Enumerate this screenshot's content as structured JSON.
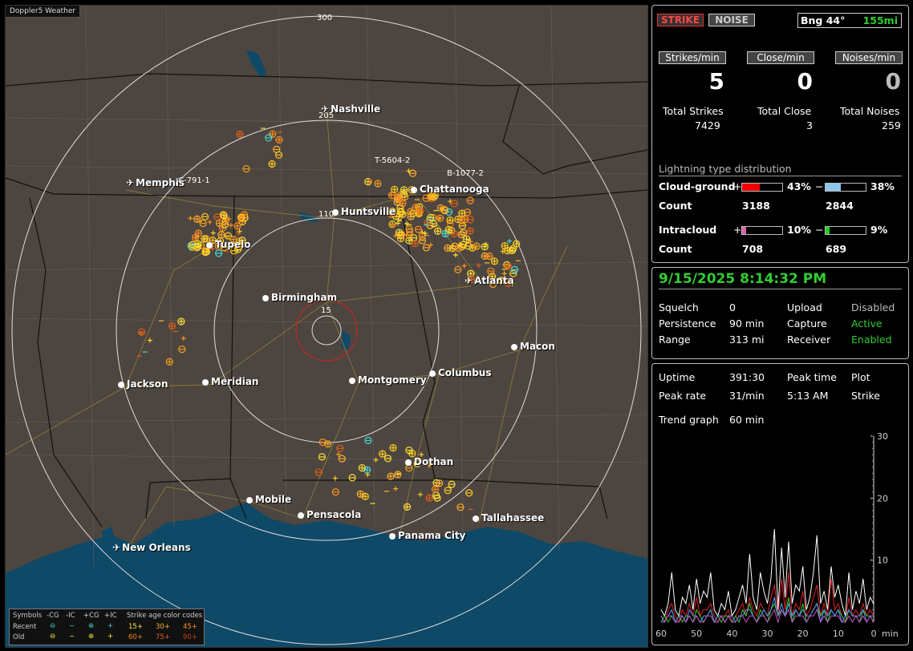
{
  "app_title": "Doppler5 Weather",
  "map": {
    "range_labels": [
      "300",
      "205",
      "110",
      "15"
    ],
    "cities": [
      {
        "name": "Nashville",
        "kind": "airport"
      },
      {
        "name": "Memphis",
        "kind": "airport"
      },
      {
        "name": "Chattanooga",
        "kind": "city"
      },
      {
        "name": "Huntsville",
        "kind": "city"
      },
      {
        "name": "Tupelo",
        "kind": "city"
      },
      {
        "name": "Atlanta",
        "kind": "airport"
      },
      {
        "name": "Birmingham",
        "kind": "city"
      },
      {
        "name": "Macon",
        "kind": "city"
      },
      {
        "name": "Jackson",
        "kind": "city"
      },
      {
        "name": "Meridian",
        "kind": "city"
      },
      {
        "name": "Montgomery",
        "kind": "city"
      },
      {
        "name": "Columbus",
        "kind": "city"
      },
      {
        "name": "Dothan",
        "kind": "city"
      },
      {
        "name": "Mobile",
        "kind": "city"
      },
      {
        "name": "Pensacola",
        "kind": "city"
      },
      {
        "name": "Tallahassee",
        "kind": "city"
      },
      {
        "name": "Panama City",
        "kind": "city"
      },
      {
        "name": "New Orleans",
        "kind": "airport"
      }
    ],
    "cell_labels": [
      "T-5604-2",
      "B-1077-2",
      "C-791-1"
    ],
    "legend": {
      "symbols_label": "Symbols",
      "headers": [
        "-CG",
        "-IC",
        "+CG",
        "+IC"
      ],
      "recent_label": "Recent",
      "old_label": "Old",
      "age_title": "Strike age color codes",
      "recent_ages": [
        "15+",
        "30+",
        "45+"
      ],
      "old_ages": [
        "60+",
        "75+",
        "90+"
      ]
    }
  },
  "status": {
    "strike_button": "STRIKE",
    "noise_button": "NOISE",
    "bearing": "Bng 44°",
    "distance": "155mi",
    "strikes_per_min_label": "Strikes/min",
    "close_per_min_label": "Close/min",
    "noises_per_min_label": "Noises/min",
    "strikes_per_min": "5",
    "close_per_min": "0",
    "noises_per_min": "0",
    "total_strikes_label": "Total Strikes",
    "total_close_label": "Total Close",
    "total_noises_label": "Total Noises",
    "total_strikes": "7429",
    "total_close": "3",
    "total_noises": "259"
  },
  "distribution": {
    "title": "Lightning type distribution",
    "cg_label": "Cloud-ground",
    "ic_label": "Intracloud",
    "count_label": "Count",
    "plus": "+",
    "minus": "−",
    "cg_pos_pct": "43%",
    "cg_neg_pct": "38%",
    "cg_pos_count": "3188",
    "cg_neg_count": "2844",
    "ic_pos_pct": "10%",
    "ic_neg_pct": "9%",
    "ic_pos_count": "708",
    "ic_neg_count": "689",
    "cg_pos_fraction": 0.43,
    "cg_neg_fraction": 0.38,
    "ic_pos_fraction": 0.1,
    "ic_neg_fraction": 0.09
  },
  "settings": {
    "datetime": "9/15/2025 8:14:32 PM",
    "squelch_label": "Squelch",
    "squelch": "0",
    "persistence_label": "Persistence",
    "persistence": "90 min",
    "range_label": "Range",
    "range": "313 mi",
    "upload_label": "Upload",
    "upload": "Disabled",
    "capture_label": "Capture",
    "capture": "Active",
    "receiver_label": "Receiver",
    "receiver": "Enabled"
  },
  "stats": {
    "uptime_label": "Uptime",
    "uptime": "391:30",
    "peak_time_label": "Peak time",
    "peak_time": "5:13 AM",
    "plot_label": "Plot",
    "plot": "Strike",
    "peak_rate_label": "Peak rate",
    "peak_rate": "31/min",
    "trend_label": "Trend graph",
    "trend": "60 min"
  },
  "chart_data": {
    "type": "line",
    "x_tick_labels": [
      "60",
      "50",
      "40",
      "30",
      "20",
      "10",
      "0"
    ],
    "x_unit": "min",
    "y_tick_labels": [
      "30",
      "20",
      "10"
    ],
    "ylim": [
      0,
      30
    ],
    "xlim": [
      60,
      0
    ],
    "series": [
      {
        "color": "#ffffff",
        "values": [
          2,
          1,
          3,
          8,
          2,
          1,
          4,
          3,
          6,
          2,
          7,
          3,
          5,
          4,
          8,
          2,
          1,
          3,
          2,
          5,
          1,
          2,
          4,
          6,
          3,
          11,
          4,
          2,
          8,
          5,
          3,
          7,
          15,
          2,
          12,
          4,
          13,
          3,
          6,
          5,
          9,
          2,
          4,
          8,
          14,
          3,
          5,
          2,
          9,
          4,
          6,
          3,
          1,
          8,
          2,
          5,
          3,
          7,
          2,
          4,
          3
        ]
      },
      {
        "color": "#dd2222",
        "values": [
          1,
          0,
          2,
          3,
          1,
          0,
          2,
          1,
          3,
          1,
          4,
          1,
          2,
          2,
          3,
          1,
          0,
          1,
          1,
          2,
          0,
          1,
          2,
          3,
          1,
          4,
          2,
          1,
          3,
          2,
          1,
          4,
          6,
          1,
          7,
          2,
          8,
          1,
          3,
          2,
          5,
          1,
          2,
          4,
          6,
          1,
          3,
          1,
          7,
          2,
          3,
          1,
          0,
          4,
          1,
          2,
          1,
          3,
          1,
          2,
          1
        ]
      },
      {
        "color": "#33cc33",
        "values": [
          0,
          1,
          0,
          1,
          0,
          1,
          0,
          1,
          1,
          0,
          2,
          1,
          0,
          1,
          2,
          0,
          1,
          0,
          1,
          1,
          0,
          1,
          0,
          2,
          1,
          3,
          1,
          0,
          2,
          1,
          0,
          2,
          3,
          1,
          2,
          1,
          4,
          0,
          2,
          1,
          3,
          0,
          1,
          2,
          3,
          1,
          2,
          0,
          2,
          1,
          2,
          1,
          0,
          2,
          1,
          1,
          0,
          2,
          1,
          1,
          0
        ]
      },
      {
        "color": "#5599ff",
        "values": [
          1,
          0,
          1,
          2,
          0,
          1,
          1,
          0,
          2,
          1,
          1,
          0,
          1,
          1,
          2,
          0,
          1,
          1,
          0,
          1,
          1,
          0,
          1,
          1,
          2,
          2,
          1,
          0,
          1,
          2,
          1,
          2,
          4,
          1,
          3,
          1,
          3,
          1,
          2,
          1,
          2,
          1,
          1,
          2,
          3,
          0,
          2,
          1,
          2,
          1,
          2,
          0,
          1,
          2,
          1,
          1,
          1,
          2,
          0,
          1,
          1
        ]
      },
      {
        "color": "#cc55cc",
        "values": [
          0,
          0,
          1,
          1,
          0,
          0,
          1,
          0,
          1,
          0,
          1,
          0,
          0,
          1,
          1,
          0,
          0,
          1,
          0,
          1,
          0,
          0,
          1,
          1,
          0,
          1,
          1,
          0,
          1,
          1,
          0,
          1,
          2,
          0,
          2,
          1,
          2,
          0,
          1,
          1,
          1,
          0,
          1,
          1,
          2,
          0,
          1,
          0,
          1,
          1,
          1,
          0,
          0,
          1,
          0,
          1,
          0,
          1,
          0,
          1,
          0
        ]
      }
    ]
  }
}
